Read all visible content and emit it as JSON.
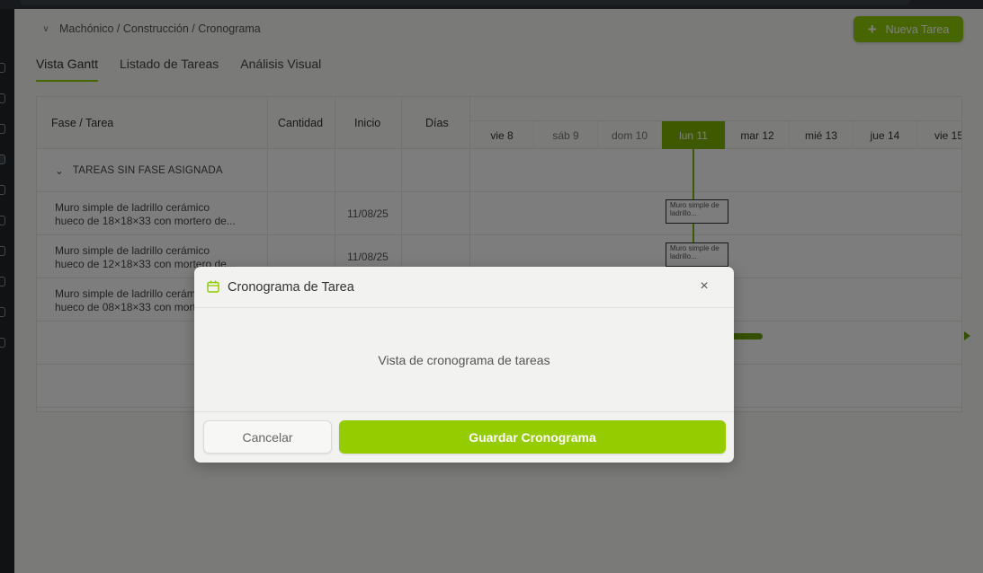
{
  "breadcrumb": {
    "parts": [
      "Machónico",
      "Construcción",
      "Cronograma"
    ],
    "text": "Machónico / Construcción / Cronograma"
  },
  "header": {
    "new_task_label": "Nueva Tarea"
  },
  "tabs": [
    {
      "label": "Vista Gantt",
      "active": true
    },
    {
      "label": "Listado de Tareas",
      "active": false
    },
    {
      "label": "Análisis Visual",
      "active": false
    }
  ],
  "table": {
    "columns": [
      "Fase / Tarea",
      "Cantidad",
      "Inicio",
      "Días"
    ],
    "days": [
      {
        "label": "vie 8",
        "weekend": false,
        "today": false
      },
      {
        "label": "sáb 9",
        "weekend": true,
        "today": false
      },
      {
        "label": "dom 10",
        "weekend": true,
        "today": false
      },
      {
        "label": "lun 11",
        "weekend": false,
        "today": true
      },
      {
        "label": "mar 12",
        "weekend": false,
        "today": false
      },
      {
        "label": "mié 13",
        "weekend": false,
        "today": false
      },
      {
        "label": "jue 14",
        "weekend": false,
        "today": false
      },
      {
        "label": "vie 15",
        "weekend": false,
        "today": false
      }
    ],
    "phase": {
      "label": "TAREAS SIN FASE ASIGNADA"
    },
    "tasks": [
      {
        "line1": "Muro simple de ladrillo cerámico",
        "line2": "hueco de 18×18×33 con mortero de...",
        "start": "11/08/25",
        "bar_text": "Muro simple de ladrillo..."
      },
      {
        "line1": "Muro simple de ladrillo cerámico",
        "line2": "hueco de 12×18×33 con mortero de...",
        "start": "11/08/25",
        "bar_text": "Muro simple de ladrillo..."
      },
      {
        "line1": "Muro simple de ladrillo cerámico",
        "line2": "hueco de 08×18×33 con mortero de...",
        "start": "",
        "bar_text": ""
      }
    ]
  },
  "modal": {
    "title": "Cronograma de Tarea",
    "body_text": "Vista de cronograma de tareas",
    "cancel_label": "Cancelar",
    "save_label": "Guardar Cronograma",
    "close_symbol": "×"
  },
  "colors": {
    "accent": "#95cc00",
    "today": "#7cb300",
    "overlay": "rgba(0,0,0,0.5)"
  }
}
